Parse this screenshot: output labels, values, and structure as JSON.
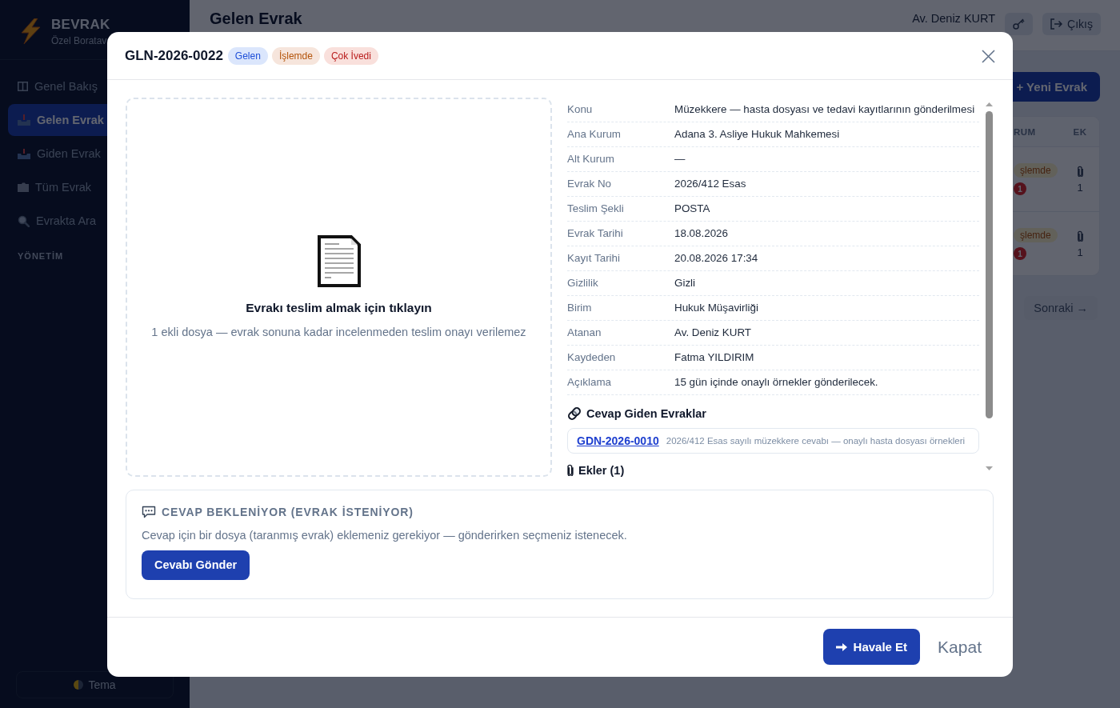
{
  "sidebar": {
    "brand": {
      "name": "BEVRAK",
      "subtitle": "Özel Boratav"
    },
    "items": [
      {
        "label": "Genel Bakış",
        "selected": false
      },
      {
        "label": "Gelen Evrak",
        "selected": true
      },
      {
        "label": "Giden Evrak",
        "selected": false
      },
      {
        "label": "Tüm Evrak",
        "selected": false
      },
      {
        "label": "Evrakta Ara",
        "selected": false
      }
    ],
    "section_label": "YÖNETİM",
    "theme_button": "Tema"
  },
  "header": {
    "title": "Gelen Evrak",
    "user": "Av. Deniz KURT",
    "logout_button": "Çıkış"
  },
  "toolbar": {
    "new_button": "+ Yeni Evrak"
  },
  "table": {
    "columns": [
      "RUM",
      "EK"
    ],
    "rows": [
      {
        "status": "şlemde",
        "count_badge": "1",
        "attachments": "1"
      },
      {
        "status": "şlemde",
        "count_badge": "1",
        "attachments": "1"
      }
    ]
  },
  "pagination": {
    "next_button": "Sonraki →"
  },
  "modal": {
    "title": "GLN-2026-0022",
    "badges": [
      {
        "label": "Gelen",
        "color": "#1d4ed8"
      },
      {
        "label": "İşlemde",
        "color": "#b45309"
      },
      {
        "label": "Çok İvedi",
        "color": "#b91c1c"
      }
    ],
    "dropzone": {
      "title": "Evrakı teslim almak için tıklayın",
      "hint": "1 ekli dosya — evrak sonuna kadar incelenmeden teslim onayı verilemez"
    },
    "details": [
      {
        "label": "Konu",
        "value": "Müzekkere — hasta dosyası ve tedavi kayıtlarının gönderilmesi"
      },
      {
        "label": "Ana Kurum",
        "value": "Adana 3. Asliye Hukuk Mahkemesi"
      },
      {
        "label": "Alt Kurum",
        "value": "—"
      },
      {
        "label": "Evrak No",
        "value": "2026/412 Esas"
      },
      {
        "label": "Teslim Şekli",
        "value": "POSTA"
      },
      {
        "label": "Evrak Tarihi",
        "value": "18.08.2026"
      },
      {
        "label": "Kayıt Tarihi",
        "value": "20.08.2026 17:34"
      },
      {
        "label": "Gizlilik",
        "value": "Gizli"
      },
      {
        "label": "Birim",
        "value": "Hukuk Müşavirliği"
      },
      {
        "label": "Atanan",
        "value": "Av. Deniz KURT"
      },
      {
        "label": "Kaydeden",
        "value": "Fatma YILDIRIM"
      },
      {
        "label": "Açıklama",
        "value": "15 gün içinde onaylı örnekler gönderilecek."
      }
    ],
    "replies": {
      "title": "Cevap Giden Evraklar",
      "items": [
        {
          "code": "GDN-2026-0010",
          "description": "2026/412 Esas sayılı müzekkere cevabı — onaylı hasta dosyası örnekleri"
        }
      ]
    },
    "attachments": {
      "title": "Ekler (1)"
    },
    "response_box": {
      "title": "CEVAP BEKLENİYOR (EVRAK İSTENİYOR)",
      "text": "Cevap için bir dosya (taranmış evrak) eklemeniz gerekiyor — gönderirken seçmeniz istenecek.",
      "button": "Cevabı Gönder"
    },
    "footer": {
      "forward_button": "Havale Et",
      "close_button": "Kapat"
    }
  }
}
